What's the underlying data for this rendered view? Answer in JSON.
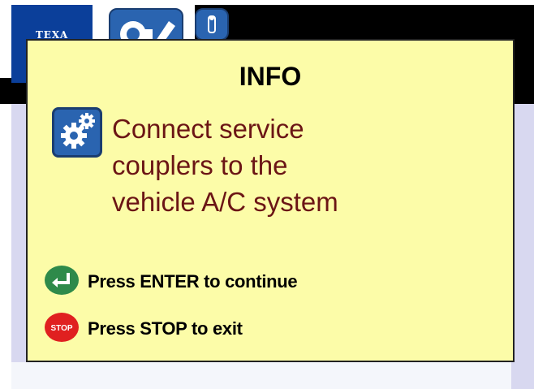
{
  "brand": {
    "logo_text": "TEXA"
  },
  "toolbar": {
    "items": [
      {
        "name": "service-tools",
        "icon": "tools-icon"
      },
      {
        "name": "key",
        "icon": "key-icon"
      }
    ]
  },
  "dialog": {
    "title": "INFO",
    "icon": "settings-gears-icon",
    "message_lines": [
      "Connect service",
      "couplers to the",
      "vehicle A/C system"
    ],
    "instructions": [
      {
        "icon": "enter-icon",
        "label": "Press ENTER to continue",
        "color": "#2e8a4a"
      },
      {
        "icon": "stop-icon",
        "icon_text": "STOP",
        "label": "Press STOP to exit",
        "color": "#e02020"
      }
    ]
  },
  "colors": {
    "dialog_background": "#fcfca8",
    "message_text": "#6b1515",
    "brand_blue": "#0b3f9a",
    "icon_blue": "#2a64b0"
  }
}
